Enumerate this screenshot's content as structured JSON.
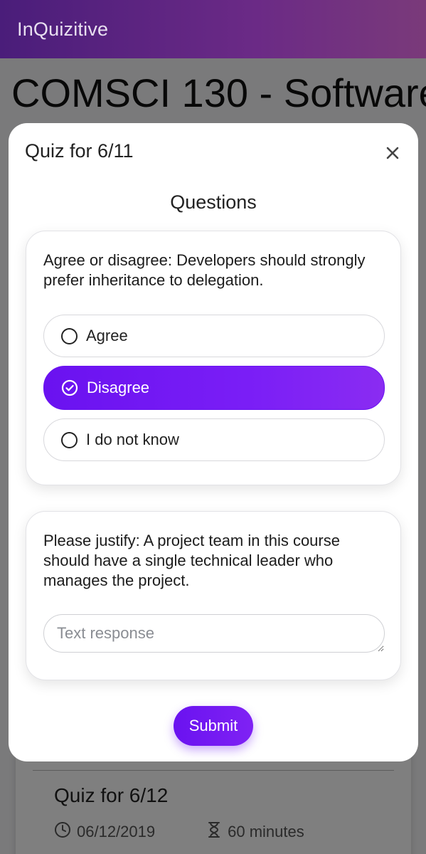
{
  "app": {
    "brand": "InQuizitive"
  },
  "course": {
    "title": "COMSCI 130 - Software"
  },
  "modal": {
    "title": "Quiz for 6/11",
    "close_label": "×",
    "section_heading": "Questions",
    "questions": [
      {
        "text": "Agree or disagree: Developers should strongly prefer inheritance to delegation.",
        "options": [
          {
            "label": "Agree",
            "selected": false
          },
          {
            "label": "Disagree",
            "selected": true
          },
          {
            "label": "I do not know",
            "selected": false
          }
        ]
      },
      {
        "text": "Please justify: A project team in this course should have a single technical leader who manages the project.",
        "response_value": "",
        "response_placeholder": "Text response"
      }
    ],
    "submit_label": "Submit"
  },
  "background_quiz": {
    "title": "Quiz for 6/12",
    "date": "06/12/2019",
    "duration": "60 minutes"
  },
  "colors": {
    "accent": "#6a12f0",
    "navbar": "#4a1d7a"
  },
  "icons": {
    "close": "close-icon",
    "radio": "radio-unchecked-icon",
    "radio_selected": "check-circle-icon",
    "clock": "clock-icon",
    "hourglass": "hourglass-icon"
  }
}
